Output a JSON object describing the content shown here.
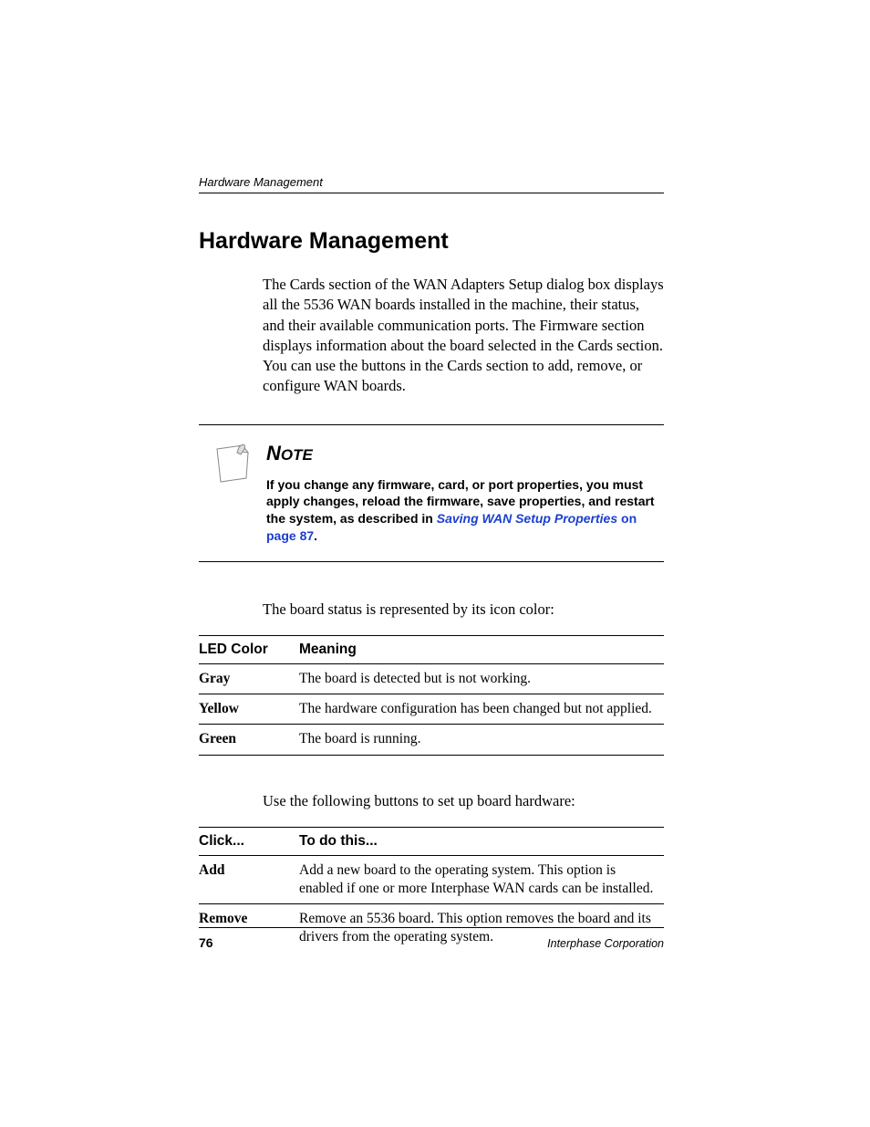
{
  "runningHeader": "Hardware Management",
  "sectionTitle": "Hardware Management",
  "bodyPara": "The Cards section of the WAN Adapters Setup dialog box displays all the 5536 WAN boards installed in the machine, their status, and their available communication ports. The Firmware section displays information about the board selected in the Cards section. You can use the buttons in the Cards section to add, remove, or configure WAN boards.",
  "note": {
    "headingFirst": "N",
    "headingRest": "OTE",
    "textBefore": "If you change any firmware, card, or port properties, you must apply changes, reload the firmware, save properties, and restart the system, as described in ",
    "linkText": "Saving WAN Setup Properties",
    "linkSuffix": " on page 87",
    "textAfter": "."
  },
  "ledIntro": "The board status is represented by its icon color:",
  "ledTable": {
    "headers": {
      "col1": "LED Color",
      "col2": "Meaning"
    },
    "rows": [
      {
        "col1": "Gray",
        "col2": "The board is detected but is not working."
      },
      {
        "col1": "Yellow",
        "col2": "The hardware configuration has been changed but not applied."
      },
      {
        "col1": "Green",
        "col2": "The board is running."
      }
    ]
  },
  "btnIntro": "Use the following buttons to set up board hardware:",
  "btnTable": {
    "headers": {
      "col1": "Click...",
      "col2": "To do this..."
    },
    "rows": [
      {
        "col1": "Add",
        "col2": "Add a new board to the operating system. This option is enabled if one or more Interphase WAN cards can be installed."
      },
      {
        "col1": "Remove",
        "col2": "Remove an 5536 board. This option removes the board and its drivers from the operating system."
      }
    ]
  },
  "footer": {
    "pageNumber": "76",
    "corp": "Interphase Corporation"
  }
}
